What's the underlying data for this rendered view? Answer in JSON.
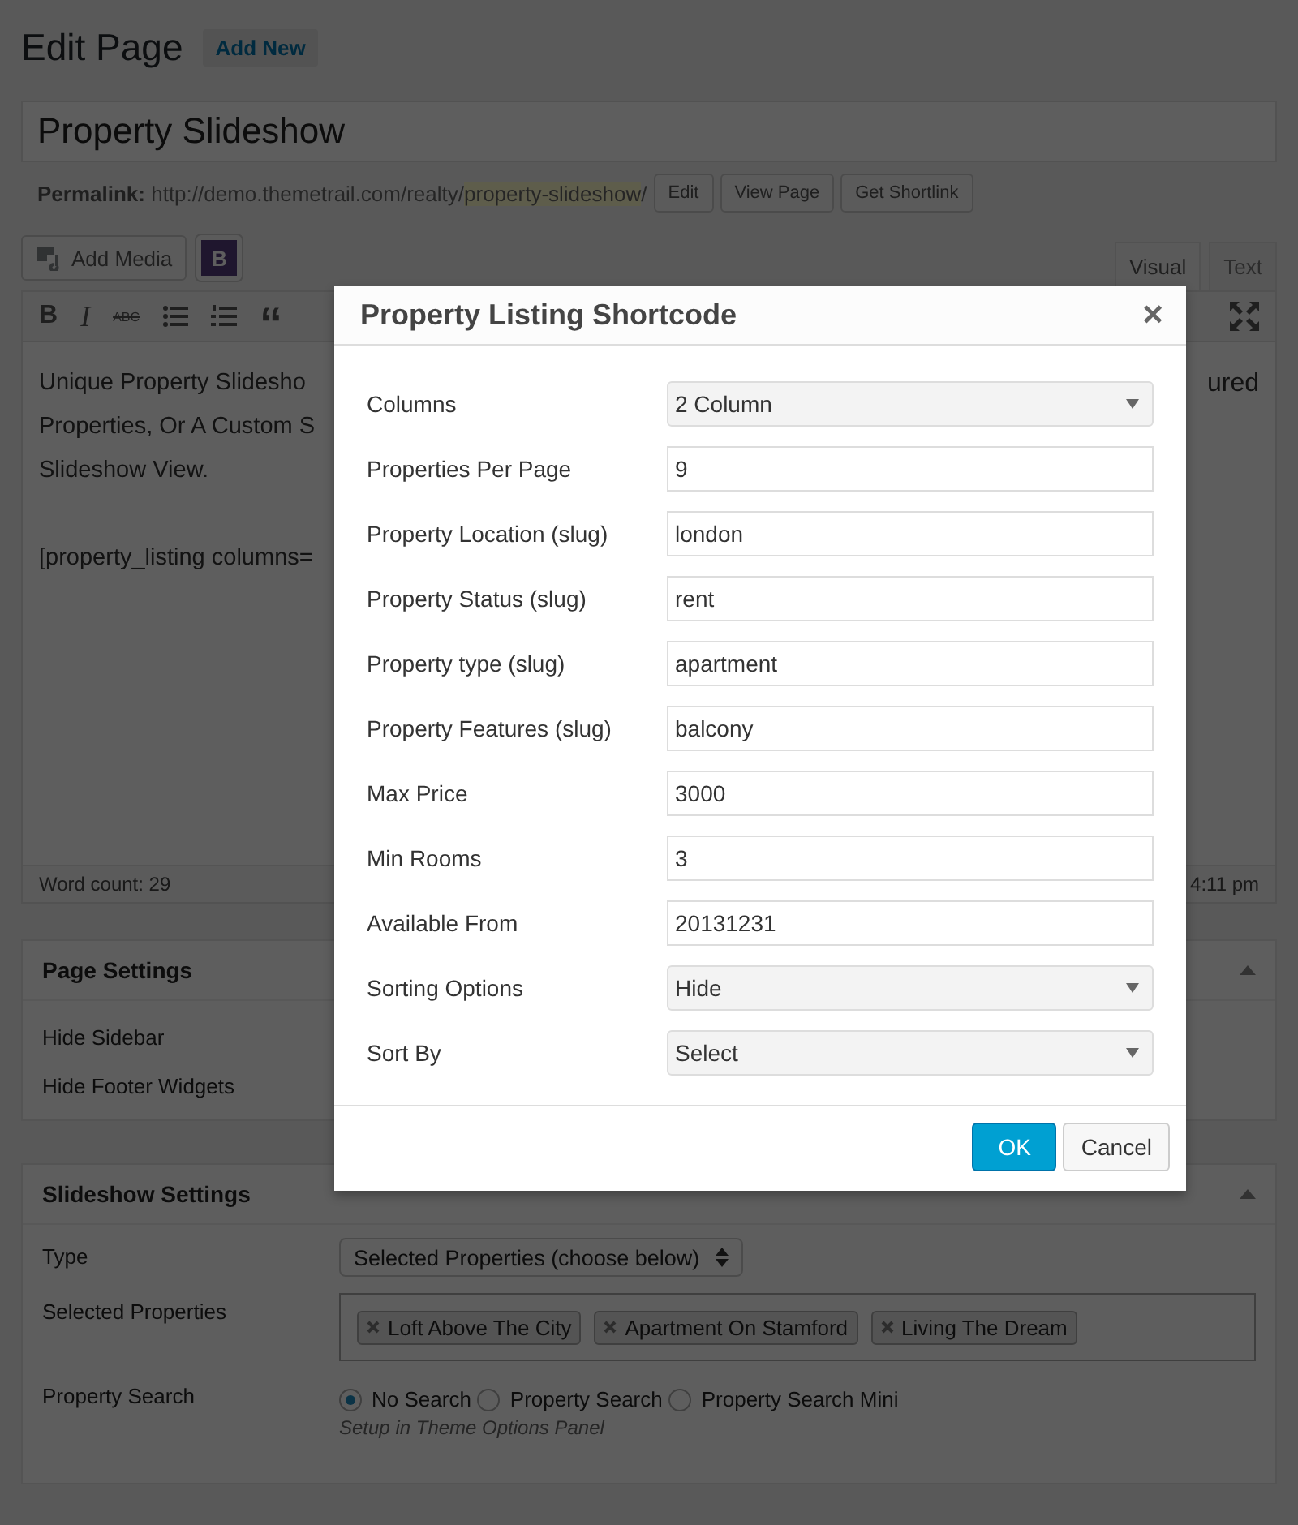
{
  "header": {
    "title": "Edit Page",
    "add_new": "Add New"
  },
  "post_title": "Property Slideshow",
  "permalink": {
    "label": "Permalink:",
    "url_base": "http://demo.themetrail.com/realty/",
    "slug": "property-slideshow",
    "trailing": "/",
    "buttons": [
      "Edit",
      "View Page",
      "Get Shortlink"
    ]
  },
  "add_media": "Add Media",
  "plugin_button": "B",
  "editor_tabs": [
    {
      "label": "Visual",
      "selected": true
    },
    {
      "label": "Text",
      "selected": false
    }
  ],
  "toolbar": [
    {
      "kind": "bold",
      "glyph": "B"
    },
    {
      "kind": "italic",
      "glyph": "I"
    },
    {
      "kind": "strike",
      "glyph": "ABC"
    },
    {
      "kind": "bullets"
    },
    {
      "kind": "numbers"
    },
    {
      "kind": "quote",
      "glyph": "“"
    }
  ],
  "editor_text": {
    "lines": [
      "Unique Property Slidesho",
      "Properties, Or A Custom S",
      "Slideshow View."
    ],
    "shortcode": "[property_listing columns=",
    "right_fragment": "ured"
  },
  "status": {
    "word_count": "Word count: 29",
    "time": "4:11 pm"
  },
  "page_settings": {
    "title": "Page Settings",
    "rows": [
      "Hide Sidebar",
      "Hide Footer Widgets"
    ]
  },
  "slideshow_settings": {
    "title": "Slideshow Settings",
    "type_label": "Type",
    "type_value": "Selected Properties (choose below)",
    "selected_label": "Selected Properties",
    "tags": [
      "Loft Above The City",
      "Apartment On Stamford",
      "Living The Dream"
    ],
    "search_label": "Property Search",
    "search_options": [
      {
        "label": "No Search",
        "selected": true
      },
      {
        "label": "Property Search",
        "selected": false
      },
      {
        "label": "Property Search Mini",
        "selected": false
      }
    ],
    "hint": "Setup in Theme Options Panel"
  },
  "modal": {
    "title": "Property Listing Shortcode",
    "close": "×",
    "fields": [
      {
        "label": "Columns",
        "kind": "select",
        "value": "2 Column"
      },
      {
        "label": "Properties Per Page",
        "kind": "text",
        "value": "9"
      },
      {
        "label": "Property Location (slug)",
        "kind": "text",
        "value": "london"
      },
      {
        "label": "Property Status (slug)",
        "kind": "text",
        "value": "rent"
      },
      {
        "label": "Property type (slug)",
        "kind": "text",
        "value": "apartment"
      },
      {
        "label": "Property Features (slug)",
        "kind": "text",
        "value": "balcony"
      },
      {
        "label": "Max Price",
        "kind": "text",
        "value": "3000"
      },
      {
        "label": "Min Rooms",
        "kind": "text",
        "value": "3"
      },
      {
        "label": "Available From",
        "kind": "text",
        "value": "20131231"
      },
      {
        "label": "Sorting Options",
        "kind": "select",
        "value": "Hide"
      },
      {
        "label": "Sort By",
        "kind": "select",
        "value": "Select"
      }
    ],
    "buttons": [
      {
        "label": "OK",
        "kind": "primary"
      },
      {
        "label": "Cancel",
        "kind": "secondary"
      }
    ]
  }
}
